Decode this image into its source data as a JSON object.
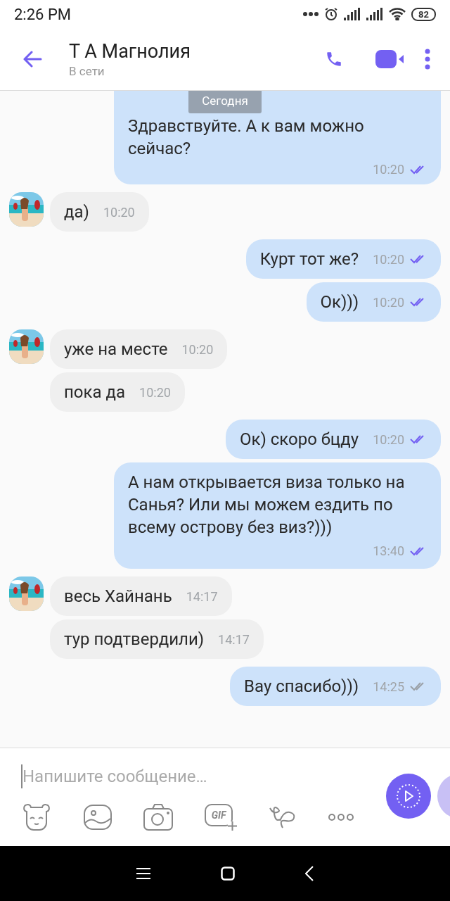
{
  "status_bar": {
    "time": "2:26 PM",
    "battery": "82"
  },
  "header": {
    "title": "Т А Магнолия",
    "subtitle": "В сети"
  },
  "date_badge": "Сегодня",
  "messages": [
    {
      "kind": "outgoing",
      "text": "Здравствуйте. А к вам можно сейчас?",
      "time": "10:20",
      "read": true
    },
    {
      "kind": "incoming",
      "avatar": true,
      "text": "да)",
      "time": "10:20"
    },
    {
      "kind": "outgoing",
      "text": "Курт тот же?",
      "time": "10:20",
      "read": true
    },
    {
      "kind": "outgoing",
      "text": "Ок)))",
      "time": "10:20",
      "read": true
    },
    {
      "kind": "incoming",
      "avatar": true,
      "text": "уже на месте",
      "time": "10:20"
    },
    {
      "kind": "incoming",
      "avatar": false,
      "text": "пока да",
      "time": "10:20"
    },
    {
      "kind": "outgoing",
      "text": "Ок) скоро бцду",
      "time": "10:20",
      "read": true
    },
    {
      "kind": "outgoing",
      "text": "А нам открывается виза только на Санья? Или мы можем ездить по всему острову без виз?)))",
      "time": "13:40",
      "read": true
    },
    {
      "kind": "incoming",
      "avatar": true,
      "text": "весь Хайнань",
      "time": "14:17"
    },
    {
      "kind": "incoming",
      "avatar": false,
      "text": "тур подтвердили)",
      "time": "14:17"
    },
    {
      "kind": "outgoing",
      "text": "Вау спасибо)))",
      "time": "14:25",
      "read": false
    }
  ],
  "composer": {
    "placeholder": "Напишите сообщение…",
    "gif_label": "GIF"
  }
}
